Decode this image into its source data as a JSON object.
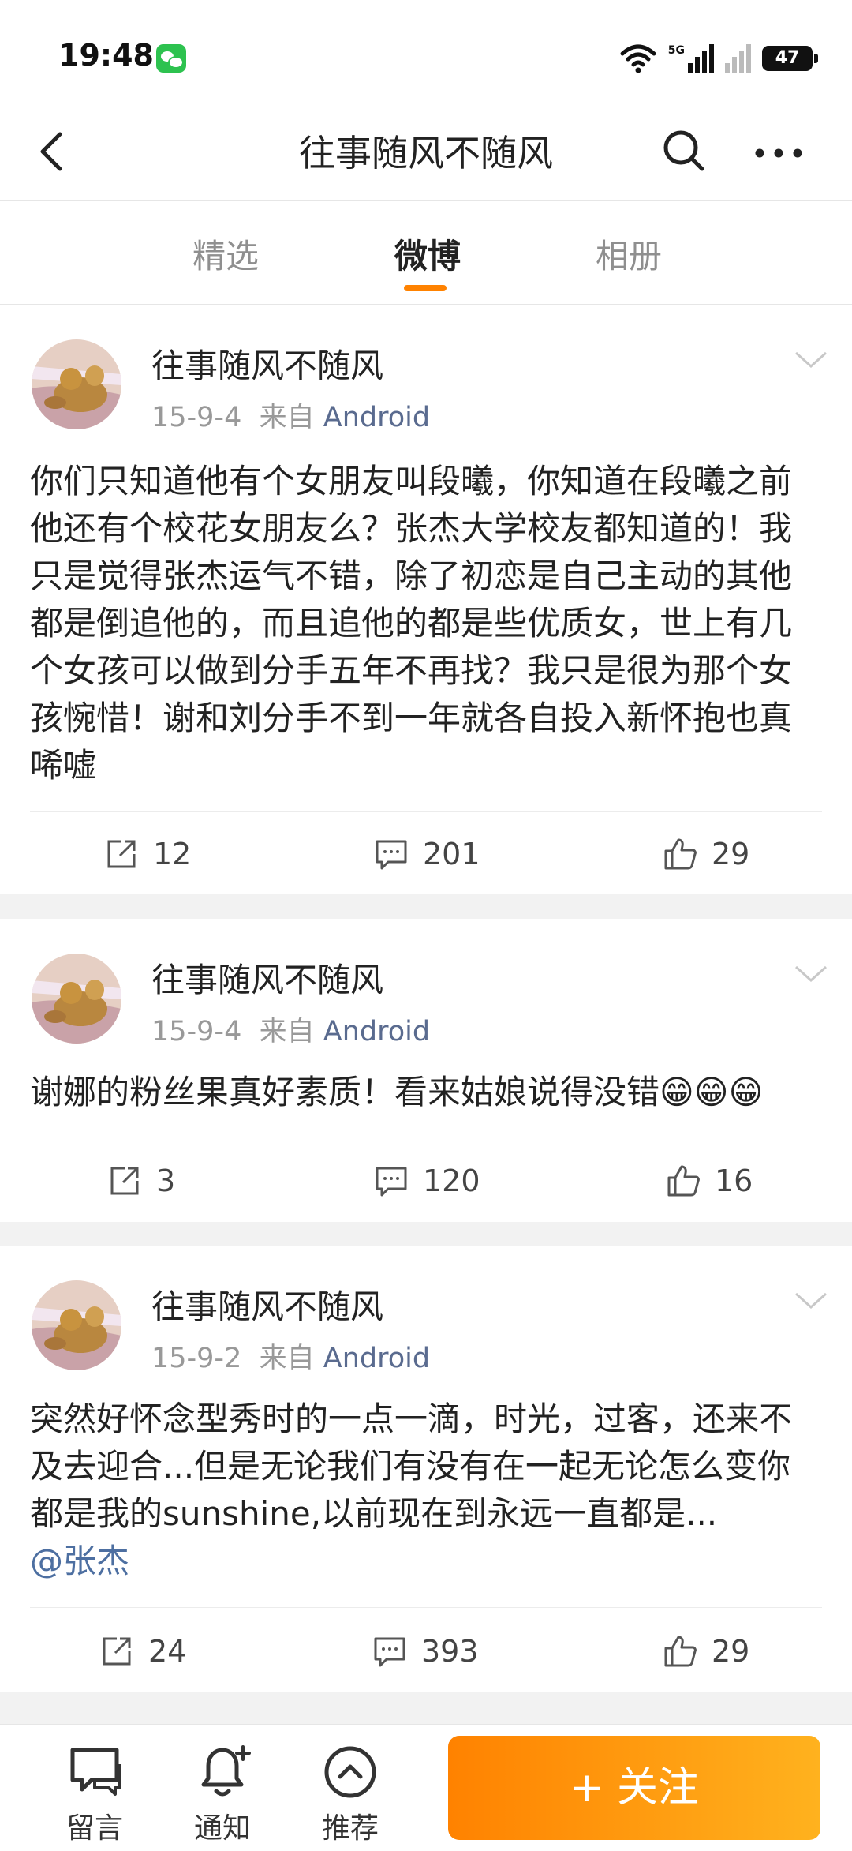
{
  "status_bar": {
    "time": "19:48",
    "network": "5G",
    "battery": "47"
  },
  "header": {
    "title": "往事随风不随风"
  },
  "tabs": [
    {
      "label": "精选"
    },
    {
      "label": "微博"
    },
    {
      "label": "相册"
    }
  ],
  "active_tab": "微博",
  "posts": [
    {
      "author": "往事随风不随风",
      "date": "15-9-4",
      "source_prefix": "来自",
      "source": "Android",
      "text": "你们只知道他有个女朋友叫段曦，你知道在段曦之前他还有个校花女朋友么？张杰大学校友都知道的！我只是觉得张杰运气不错，除了初恋是自己主动的其他都是倒追他的，而且追他的都是些优质女，世上有几个女孩可以做到分手五年不再找？我只是很为那个女孩惋惜！谢和刘分手不到一年就各自投入新怀抱也真唏嘘",
      "reposts": "12",
      "comments": "201",
      "likes": "29"
    },
    {
      "author": "往事随风不随风",
      "date": "15-9-4",
      "source_prefix": "来自",
      "source": "Android",
      "text": "谢娜的粉丝果真好素质！看来姑娘说得没错😁😁😁",
      "reposts": "3",
      "comments": "120",
      "likes": "16"
    },
    {
      "author": "往事随风不随风",
      "date": "15-9-2",
      "source_prefix": "来自",
      "source": "Android",
      "text": "突然好怀念型秀时的一点一滴，时光，过客，还来不及去迎合...但是无论我们有没有在一起无论怎么变你都是我的sunshine,以前现在到永远一直都是...",
      "mention": "@张杰",
      "reposts": "24",
      "comments": "393",
      "likes": "29"
    }
  ],
  "bottom_bar": {
    "message_label": "留言",
    "notify_label": "通知",
    "recommend_label": "推荐",
    "follow_label": "+ 关注"
  },
  "colors": {
    "accent": "#ff8200",
    "link": "#5a6b8f"
  }
}
